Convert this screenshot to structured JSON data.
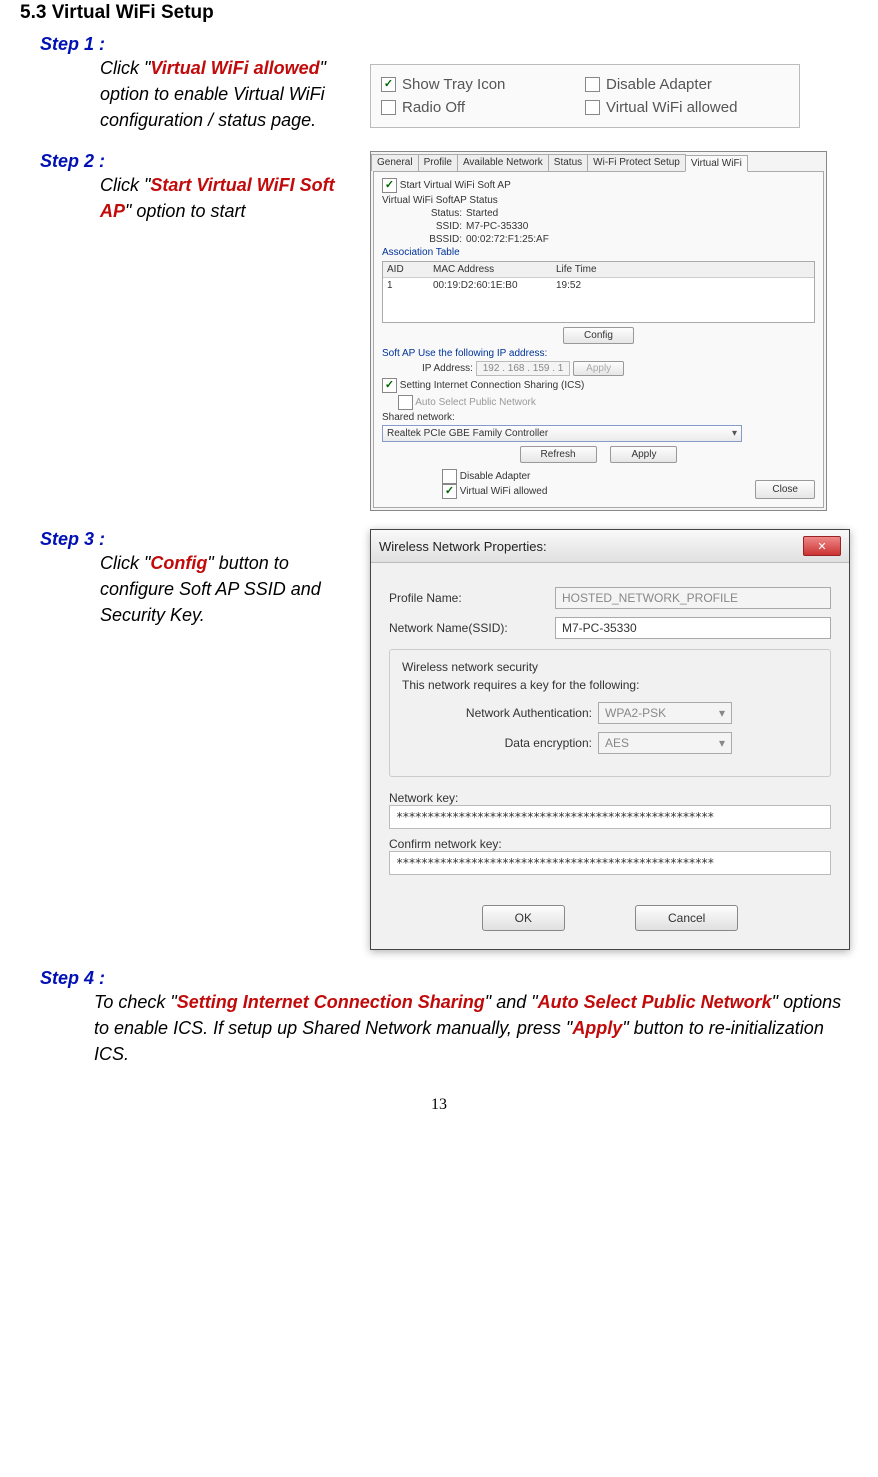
{
  "section_title": "5.3 Virtual WiFi Setup",
  "step1": {
    "heading": "Step 1 :",
    "pre": "Click \"",
    "em": "Virtual WiFi allowed",
    "post": "\" option to enable Virtual WiFi configuration / status page."
  },
  "fig1": {
    "show_tray": "Show Tray Icon",
    "disable_adapter": "Disable Adapter",
    "radio_off": "Radio Off",
    "virtual_wifi": "Virtual WiFi allowed"
  },
  "step2": {
    "heading": "Step 2 :",
    "pre": "Click \"",
    "em": "Start Virtual WiFI Soft AP",
    "post": "\" option to start"
  },
  "fig2": {
    "tabs": [
      "General",
      "Profile",
      "Available Network",
      "Status",
      "Wi-Fi Protect Setup",
      "Virtual WiFi"
    ],
    "active_tab_index": 5,
    "start_chk": "Start Virtual WiFi Soft AP",
    "status_title": "Virtual WiFi SoftAP Status",
    "status_label": "Status:",
    "status_val": "Started",
    "ssid_label": "SSID:",
    "ssid_val": "M7-PC-35330",
    "bssid_label": "BSSID:",
    "bssid_val": "00:02:72:F1:25:AF",
    "assoc_title": "Association Table",
    "cols": {
      "aid": "AID",
      "mac": "MAC Address",
      "life": "Life Time"
    },
    "row": {
      "aid": "1",
      "mac": "00:19:D2:60:1E:B0",
      "life": "19:52"
    },
    "config_btn": "Config",
    "softap_ip_title": "Soft AP Use the following IP address:",
    "ip_label": "IP Address:",
    "ip_val": "192 . 168 . 159 .  1",
    "apply_btn": "Apply",
    "ics_chk": "Setting Internet Connection Sharing (ICS)",
    "auto_chk": "Auto Select Public Network",
    "shared_label": "Shared network:",
    "shared_val": "Realtek PCIe GBE Family Controller",
    "refresh_btn": "Refresh",
    "apply_btn2": "Apply",
    "disable_adapter": "Disable Adapter",
    "virtual_wifi": "Virtual WiFi allowed",
    "close_btn": "Close"
  },
  "step3": {
    "heading": "Step 3 :",
    "pre": "Click \"",
    "em": "Config",
    "post": "\" button to configure Soft AP SSID and Security Key."
  },
  "fig3": {
    "title": "Wireless Network Properties:",
    "profile_label": "Profile Name:",
    "profile_val": "HOSTED_NETWORK_PROFILE",
    "ssid_label": "Network Name(SSID):",
    "ssid_val": "M7-PC-35330",
    "grp_title": "Wireless network security",
    "grp_desc": "This network requires a key for the following:",
    "auth_label": "Network Authentication:",
    "auth_val": "WPA2-PSK",
    "enc_label": "Data encryption:",
    "enc_val": "AES",
    "key_label": "Network key:",
    "key_val": "***************************************************",
    "confirm_label": "Confirm network key:",
    "confirm_val": "***************************************************",
    "ok": "OK",
    "cancel": "Cancel"
  },
  "step4": {
    "heading": "Step 4 :",
    "t1": "To check \"",
    "r1": "Setting Internet Connection Sharing",
    "t2": "\" and \"",
    "r2": "Auto Select Public Network",
    "t3": "\" options to enable ICS. If setup up Shared Network manually, press \"",
    "r3": "Apply",
    "t4": "\" button to re-initialization ICS."
  },
  "page_number": "13"
}
